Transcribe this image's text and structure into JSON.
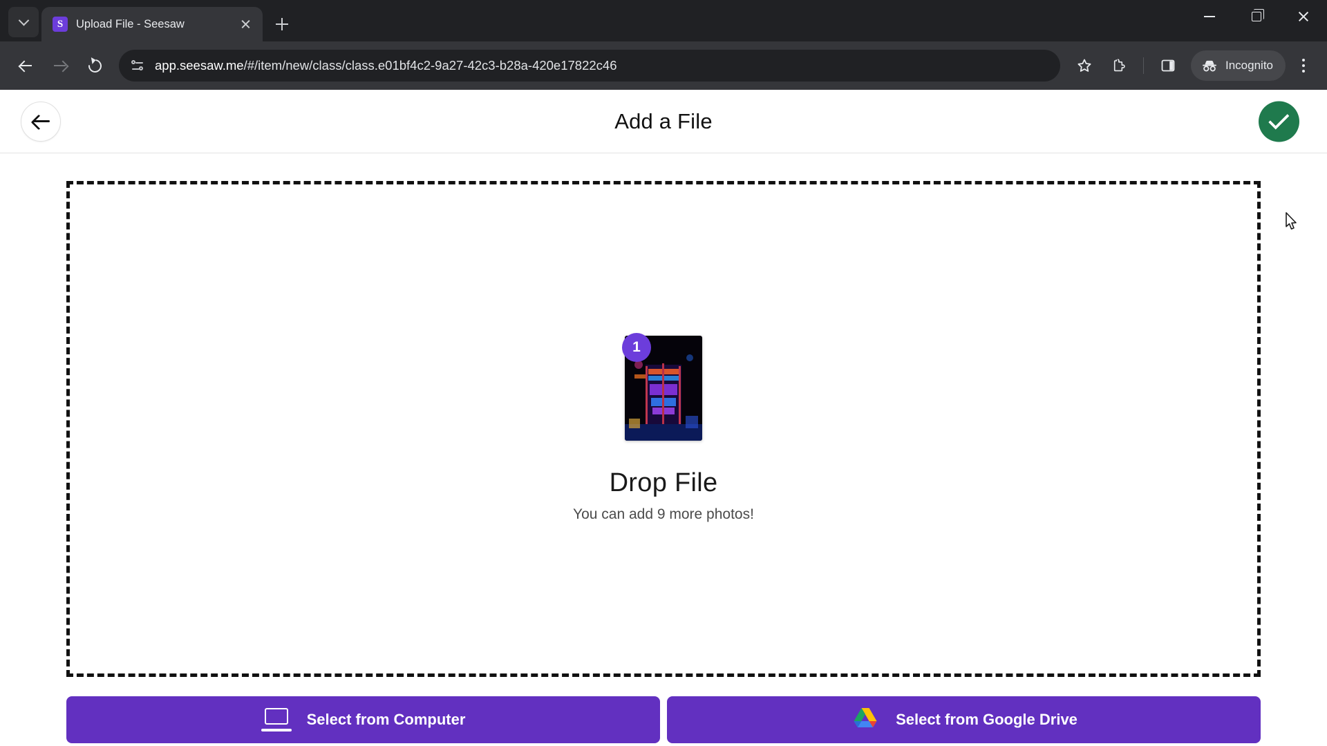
{
  "browser": {
    "tab": {
      "title": "Upload File - Seesaw",
      "favicon_letter": "S",
      "favicon_color": "#6c3ddb"
    },
    "omnibox": {
      "url_host": "app.seesaw.me",
      "url_path": "/#/item/new/class/class.e01bf4c2-9a27-42c3-b28a-420e17822c46",
      "site_icon": "tune-icon"
    },
    "profile_label": "Incognito",
    "icons": {
      "tab_search": "chevron-down-icon",
      "new_tab": "plus-icon",
      "back": "back-arrow-icon",
      "forward": "forward-arrow-icon",
      "reload": "reload-icon",
      "bookmark": "star-icon",
      "extensions": "puzzle-icon",
      "side_panel": "side-panel-icon",
      "incognito": "incognito-hat-icon",
      "menu": "kebab-menu-icon",
      "minimize": "minimize-icon",
      "maximize": "restore-icon",
      "close": "close-icon"
    }
  },
  "app": {
    "header": {
      "title": "Add a File",
      "back_icon": "back-arrow-icon",
      "done_icon": "check-icon",
      "done_color": "#1f7a4d"
    },
    "dropzone": {
      "title": "Drop File",
      "subtitle": "You can add 9 more photos!",
      "thumbnail_badge": "1",
      "badge_color": "#6c3ddb"
    },
    "actions": [
      {
        "label": "Select from Computer",
        "icon": "laptop-icon"
      },
      {
        "label": "Select from Google Drive",
        "icon": "google-drive-icon"
      }
    ],
    "accent_color": "#6230c0"
  }
}
